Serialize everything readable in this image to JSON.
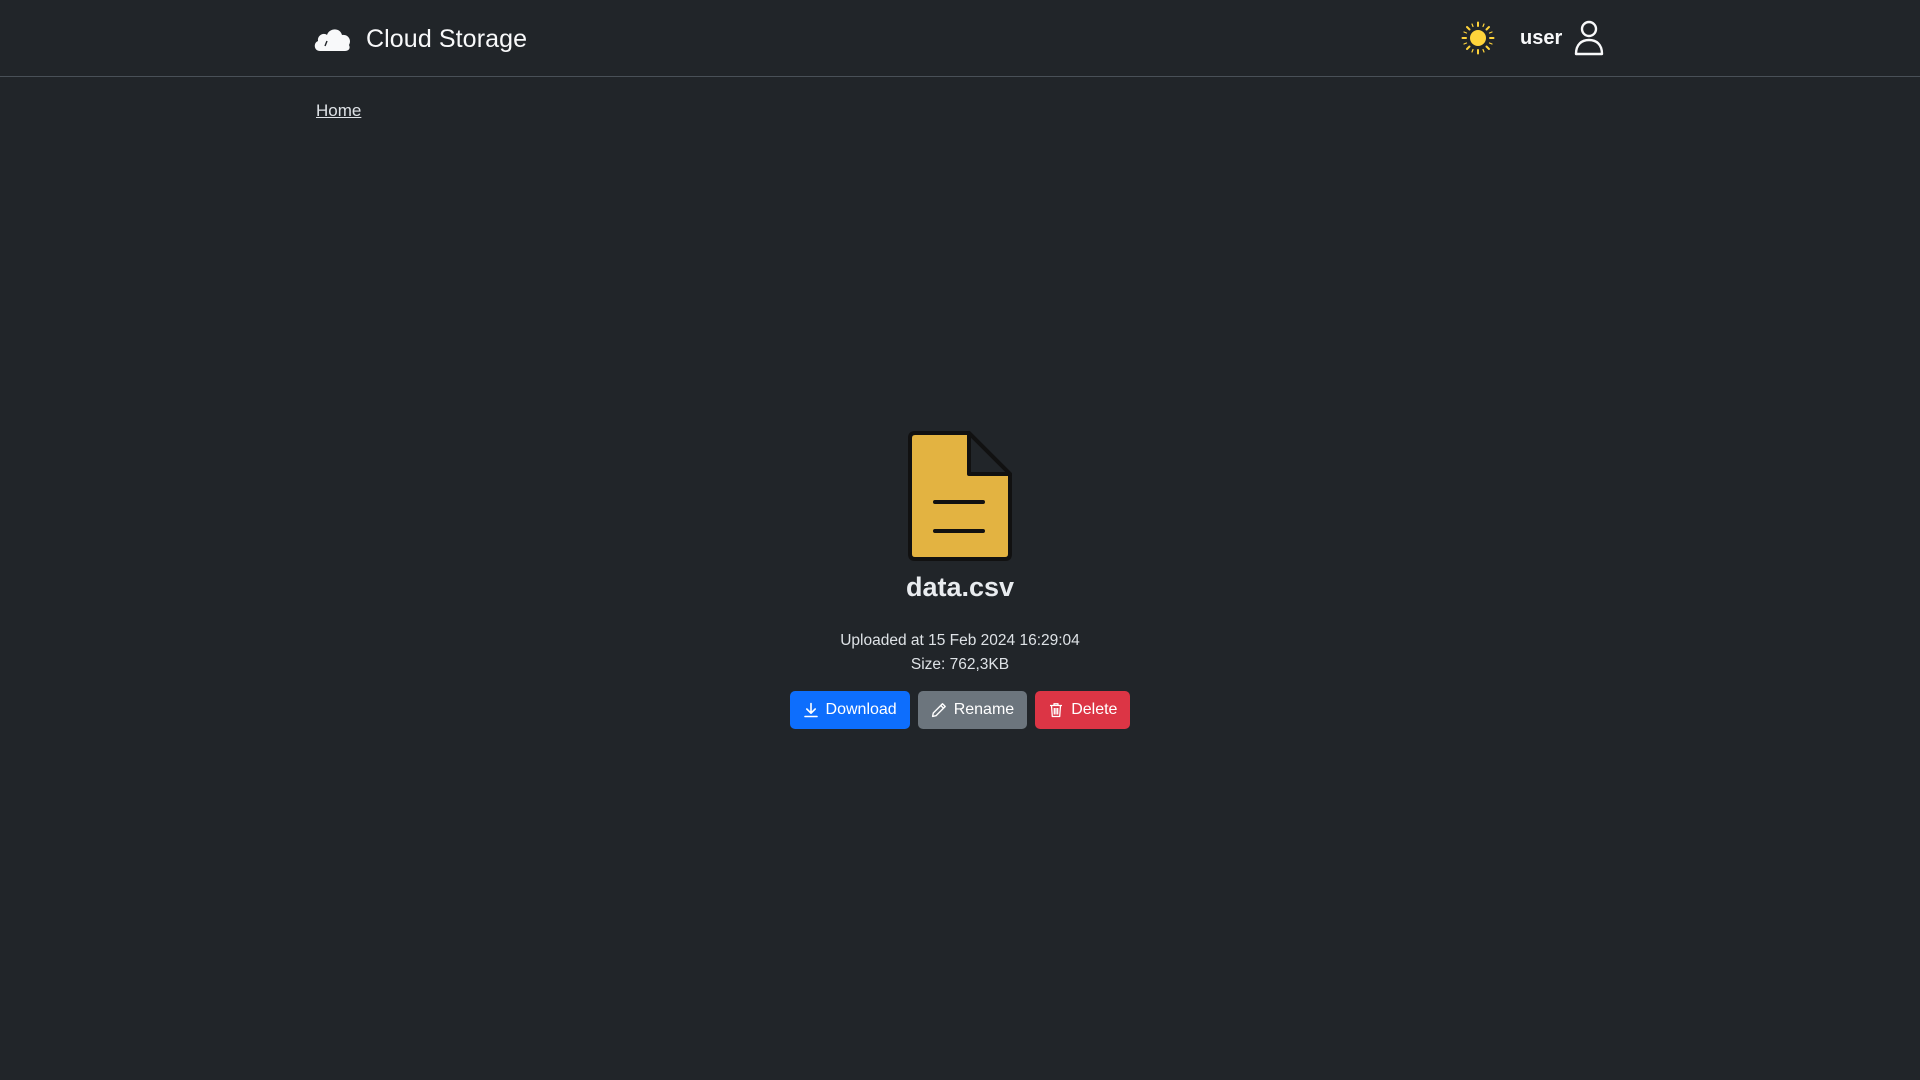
{
  "app": {
    "title": "Cloud Storage",
    "brand_icon": "cloud-icon"
  },
  "header": {
    "theme_icon": "sun-icon",
    "username": "user",
    "user_icon": "person-icon"
  },
  "breadcrumb": {
    "items": [
      "Home"
    ]
  },
  "file": {
    "icon": "file-text-icon",
    "name": "data.csv",
    "uploaded": "Uploaded at 15 Feb 2024 16:29:04",
    "size": "Size: 762,3KB"
  },
  "actions": {
    "download_label": "Download",
    "rename_label": "Rename",
    "delete_label": "Delete"
  },
  "colors": {
    "background": "#212529",
    "primary": "#0d6efd",
    "secondary": "#6c757d",
    "danger": "#dc3545",
    "file_icon": "#e3b341",
    "sun": "#ffd43b"
  }
}
